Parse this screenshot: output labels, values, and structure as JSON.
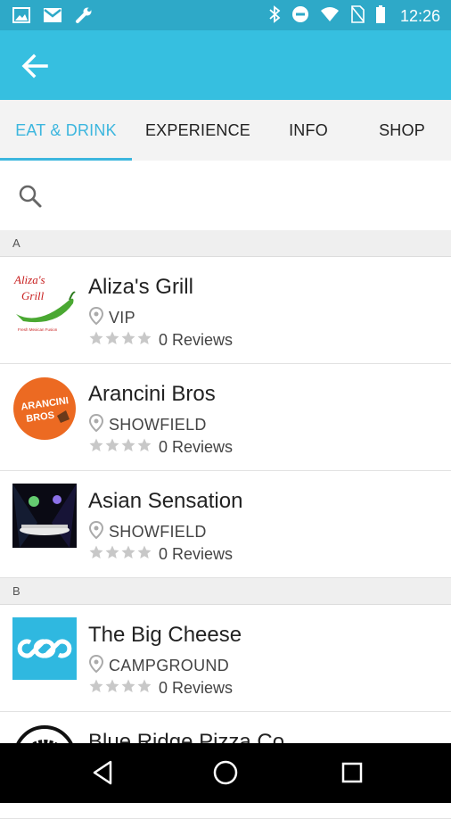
{
  "status_bar": {
    "time": "12:26",
    "icons": [
      "image-icon",
      "mail-icon",
      "wrench-icon",
      "bluetooth-icon",
      "dnd-icon",
      "wifi-icon",
      "no-sim-icon",
      "battery-icon"
    ]
  },
  "colors": {
    "status_bar": "#2ea9c8",
    "app_bar": "#36bfe0",
    "accent": "#3cb6de"
  },
  "tabs": [
    {
      "label": "EAT & DRINK",
      "active": true
    },
    {
      "label": "EXPERIENCE",
      "active": false
    },
    {
      "label": "INFO",
      "active": false
    },
    {
      "label": "SHOP",
      "active": false
    }
  ],
  "search": {
    "placeholder": ""
  },
  "sections": [
    {
      "letter": "A"
    },
    {
      "letter": "B"
    }
  ],
  "items": [
    {
      "name": "Aliza's Grill",
      "location": "VIP",
      "reviews": "0 Reviews",
      "stars": 0,
      "logo_text": "Aliza's Grill",
      "logo_sub": "Fresh Mexican Fusion"
    },
    {
      "name": "Arancini Bros",
      "location": "SHOWFIELD",
      "reviews": "0 Reviews",
      "stars": 0,
      "logo_text": "ARANCINI BROS"
    },
    {
      "name": "Asian Sensation",
      "location": "SHOWFIELD",
      "reviews": "0 Reviews",
      "stars": 0
    },
    {
      "name": "The Big Cheese",
      "location": "CAMPGROUND",
      "reviews": "0 Reviews",
      "stars": 0
    },
    {
      "name": "Blue Ridge Pizza Co",
      "location": "",
      "reviews": "",
      "stars": 0,
      "logo_text": "BLUE RIDGE"
    }
  ],
  "nav": {
    "icons": [
      "back-triangle-icon",
      "home-circle-icon",
      "recents-square-icon"
    ]
  }
}
